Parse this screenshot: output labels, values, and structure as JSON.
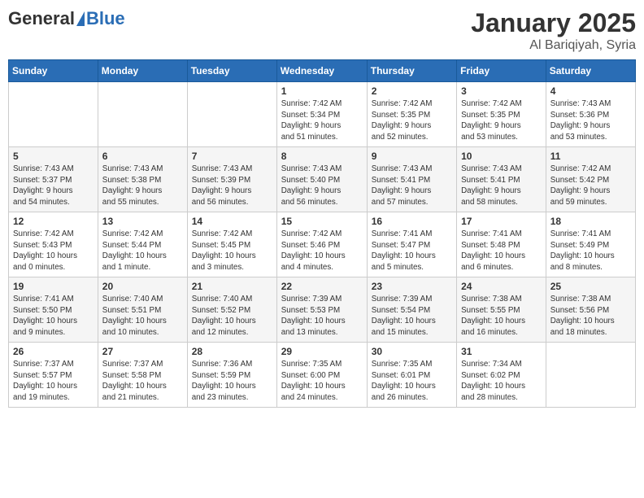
{
  "logo": {
    "general": "General",
    "blue": "Blue"
  },
  "header": {
    "month": "January 2025",
    "location": "Al Bariqiyah, Syria"
  },
  "weekdays": [
    "Sunday",
    "Monday",
    "Tuesday",
    "Wednesday",
    "Thursday",
    "Friday",
    "Saturday"
  ],
  "weeks": [
    [
      {
        "day": "",
        "info": ""
      },
      {
        "day": "",
        "info": ""
      },
      {
        "day": "",
        "info": ""
      },
      {
        "day": "1",
        "info": "Sunrise: 7:42 AM\nSunset: 5:34 PM\nDaylight: 9 hours\nand 51 minutes."
      },
      {
        "day": "2",
        "info": "Sunrise: 7:42 AM\nSunset: 5:35 PM\nDaylight: 9 hours\nand 52 minutes."
      },
      {
        "day": "3",
        "info": "Sunrise: 7:42 AM\nSunset: 5:35 PM\nDaylight: 9 hours\nand 53 minutes."
      },
      {
        "day": "4",
        "info": "Sunrise: 7:43 AM\nSunset: 5:36 PM\nDaylight: 9 hours\nand 53 minutes."
      }
    ],
    [
      {
        "day": "5",
        "info": "Sunrise: 7:43 AM\nSunset: 5:37 PM\nDaylight: 9 hours\nand 54 minutes."
      },
      {
        "day": "6",
        "info": "Sunrise: 7:43 AM\nSunset: 5:38 PM\nDaylight: 9 hours\nand 55 minutes."
      },
      {
        "day": "7",
        "info": "Sunrise: 7:43 AM\nSunset: 5:39 PM\nDaylight: 9 hours\nand 56 minutes."
      },
      {
        "day": "8",
        "info": "Sunrise: 7:43 AM\nSunset: 5:40 PM\nDaylight: 9 hours\nand 56 minutes."
      },
      {
        "day": "9",
        "info": "Sunrise: 7:43 AM\nSunset: 5:41 PM\nDaylight: 9 hours\nand 57 minutes."
      },
      {
        "day": "10",
        "info": "Sunrise: 7:43 AM\nSunset: 5:41 PM\nDaylight: 9 hours\nand 58 minutes."
      },
      {
        "day": "11",
        "info": "Sunrise: 7:42 AM\nSunset: 5:42 PM\nDaylight: 9 hours\nand 59 minutes."
      }
    ],
    [
      {
        "day": "12",
        "info": "Sunrise: 7:42 AM\nSunset: 5:43 PM\nDaylight: 10 hours\nand 0 minutes."
      },
      {
        "day": "13",
        "info": "Sunrise: 7:42 AM\nSunset: 5:44 PM\nDaylight: 10 hours\nand 1 minute."
      },
      {
        "day": "14",
        "info": "Sunrise: 7:42 AM\nSunset: 5:45 PM\nDaylight: 10 hours\nand 3 minutes."
      },
      {
        "day": "15",
        "info": "Sunrise: 7:42 AM\nSunset: 5:46 PM\nDaylight: 10 hours\nand 4 minutes."
      },
      {
        "day": "16",
        "info": "Sunrise: 7:41 AM\nSunset: 5:47 PM\nDaylight: 10 hours\nand 5 minutes."
      },
      {
        "day": "17",
        "info": "Sunrise: 7:41 AM\nSunset: 5:48 PM\nDaylight: 10 hours\nand 6 minutes."
      },
      {
        "day": "18",
        "info": "Sunrise: 7:41 AM\nSunset: 5:49 PM\nDaylight: 10 hours\nand 8 minutes."
      }
    ],
    [
      {
        "day": "19",
        "info": "Sunrise: 7:41 AM\nSunset: 5:50 PM\nDaylight: 10 hours\nand 9 minutes."
      },
      {
        "day": "20",
        "info": "Sunrise: 7:40 AM\nSunset: 5:51 PM\nDaylight: 10 hours\nand 10 minutes."
      },
      {
        "day": "21",
        "info": "Sunrise: 7:40 AM\nSunset: 5:52 PM\nDaylight: 10 hours\nand 12 minutes."
      },
      {
        "day": "22",
        "info": "Sunrise: 7:39 AM\nSunset: 5:53 PM\nDaylight: 10 hours\nand 13 minutes."
      },
      {
        "day": "23",
        "info": "Sunrise: 7:39 AM\nSunset: 5:54 PM\nDaylight: 10 hours\nand 15 minutes."
      },
      {
        "day": "24",
        "info": "Sunrise: 7:38 AM\nSunset: 5:55 PM\nDaylight: 10 hours\nand 16 minutes."
      },
      {
        "day": "25",
        "info": "Sunrise: 7:38 AM\nSunset: 5:56 PM\nDaylight: 10 hours\nand 18 minutes."
      }
    ],
    [
      {
        "day": "26",
        "info": "Sunrise: 7:37 AM\nSunset: 5:57 PM\nDaylight: 10 hours\nand 19 minutes."
      },
      {
        "day": "27",
        "info": "Sunrise: 7:37 AM\nSunset: 5:58 PM\nDaylight: 10 hours\nand 21 minutes."
      },
      {
        "day": "28",
        "info": "Sunrise: 7:36 AM\nSunset: 5:59 PM\nDaylight: 10 hours\nand 23 minutes."
      },
      {
        "day": "29",
        "info": "Sunrise: 7:35 AM\nSunset: 6:00 PM\nDaylight: 10 hours\nand 24 minutes."
      },
      {
        "day": "30",
        "info": "Sunrise: 7:35 AM\nSunset: 6:01 PM\nDaylight: 10 hours\nand 26 minutes."
      },
      {
        "day": "31",
        "info": "Sunrise: 7:34 AM\nSunset: 6:02 PM\nDaylight: 10 hours\nand 28 minutes."
      },
      {
        "day": "",
        "info": ""
      }
    ]
  ]
}
